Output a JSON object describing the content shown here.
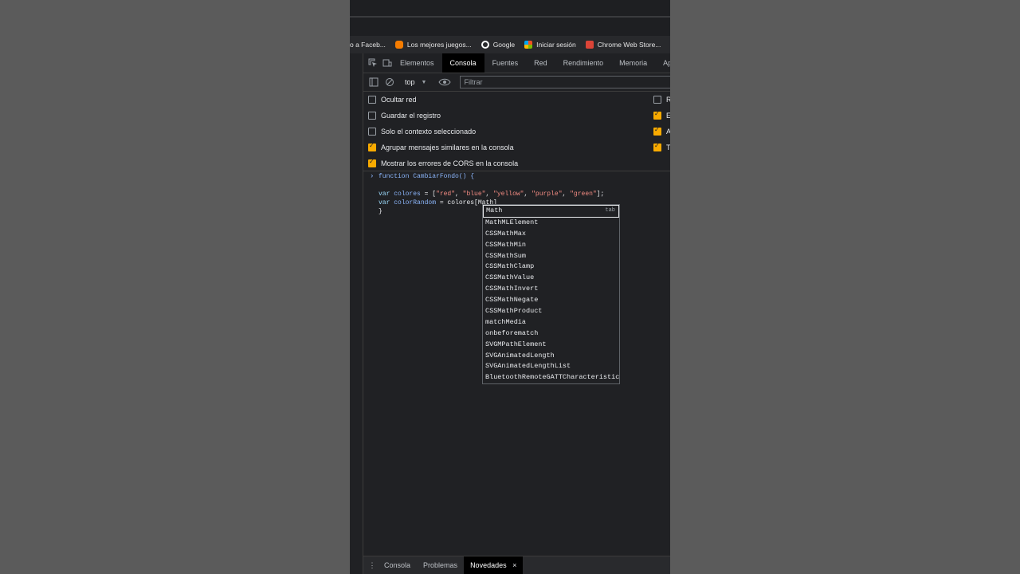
{
  "bookmarks": [
    {
      "label": "o a Faceb..."
    },
    {
      "label": "Los mejores juegos..."
    },
    {
      "label": "Google"
    },
    {
      "label": "Iniciar sesión"
    },
    {
      "label": "Chrome Web Store..."
    }
  ],
  "tabs": [
    "Elementos",
    "Consola",
    "Fuentes",
    "Red",
    "Rendimiento",
    "Memoria",
    "Ap"
  ],
  "toolbar": {
    "context": "top",
    "filter_placeholder": "Filtrar"
  },
  "settings_left": [
    {
      "label": "Ocultar red",
      "checked": false
    },
    {
      "label": "Guardar el registro",
      "checked": false
    },
    {
      "label": "Solo el contexto seleccionado",
      "checked": false
    },
    {
      "label": "Agrupar mensajes similares en la consola",
      "checked": true
    },
    {
      "label": "Mostrar los errores de CORS en la consola",
      "checked": true
    }
  ],
  "settings_right": [
    {
      "label": "R",
      "checked": false
    },
    {
      "label": "E",
      "checked": true
    },
    {
      "label": "A",
      "checked": true
    },
    {
      "label": "T",
      "checked": true
    }
  ],
  "code": {
    "line1": "function CambiarFondo() {",
    "line2_kw": "var",
    "line2_name": "colores",
    "line2_rest": " = [",
    "strings": [
      "\"red\"",
      "\"blue\"",
      "\"yellow\"",
      "\"purple\"",
      "\"green\""
    ],
    "line3_kw": "var",
    "line3_name": "colorRandom",
    "line3_rest": " = colores[Math]",
    "line4": "}"
  },
  "autocomplete": {
    "hint": "tab",
    "items": [
      "Math",
      "MathMLElement",
      "CSSMathMax",
      "CSSMathMin",
      "CSSMathSum",
      "CSSMathClamp",
      "CSSMathValue",
      "CSSMathInvert",
      "CSSMathNegate",
      "CSSMathProduct",
      "matchMedia",
      "onbeforematch",
      "SVGMPathElement",
      "SVGAnimatedLength",
      "SVGAnimatedLengthList",
      "BluetoothRemoteGATTCharacteristic"
    ]
  },
  "bottom_tabs": [
    "Consola",
    "Problemas",
    "Novedades"
  ],
  "bottom_close": "×"
}
